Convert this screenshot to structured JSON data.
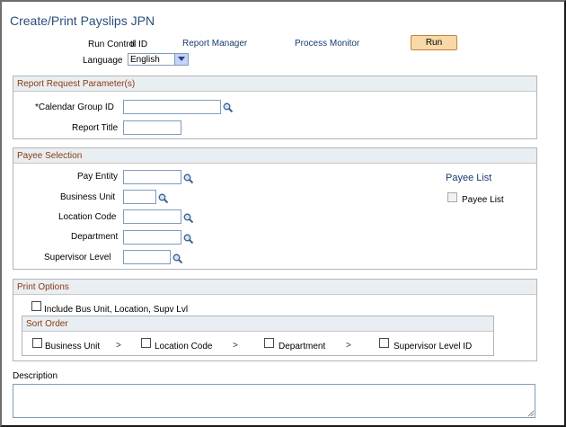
{
  "page": {
    "title": "Create/Print Payslips JPN"
  },
  "run_control": {
    "label": "Run Control ID",
    "value": "tl",
    "report_manager": "Report Manager",
    "process_monitor": "Process Monitor",
    "run_button": "Run",
    "language_label": "Language",
    "language_value": "English"
  },
  "report_params": {
    "header": "Report Request Parameter(s)",
    "calendar_group_label": "*Calendar Group ID",
    "calendar_group_value": "",
    "report_title_label": "Report Title",
    "report_title_value": ""
  },
  "payee_selection": {
    "header": "Payee Selection",
    "pay_entity_label": "Pay Entity",
    "business_unit_label": "Business Unit",
    "location_code_label": "Location Code",
    "department_label": "Department",
    "supervisor_level_label": "Supervisor Level",
    "payee_list_link": "Payee List",
    "payee_list_checkbox_label": "Payee List"
  },
  "print_options": {
    "header": "Print Options",
    "include_label": "Include Bus Unit, Location, Supv Lvl",
    "sort_order_header": "Sort Order",
    "sort_items": [
      "Business Unit",
      "Location Code",
      "Department",
      "Supervisor Level ID"
    ],
    "separator": ">"
  },
  "description": {
    "label": "Description",
    "value": ""
  },
  "icons": {
    "lookup": "magnifier-icon",
    "dropdown": "chevron-down-icon"
  },
  "colors": {
    "title": "#2b4e7a",
    "group_header_text": "#8b3b0b",
    "run_button": "#f7d9a7"
  }
}
